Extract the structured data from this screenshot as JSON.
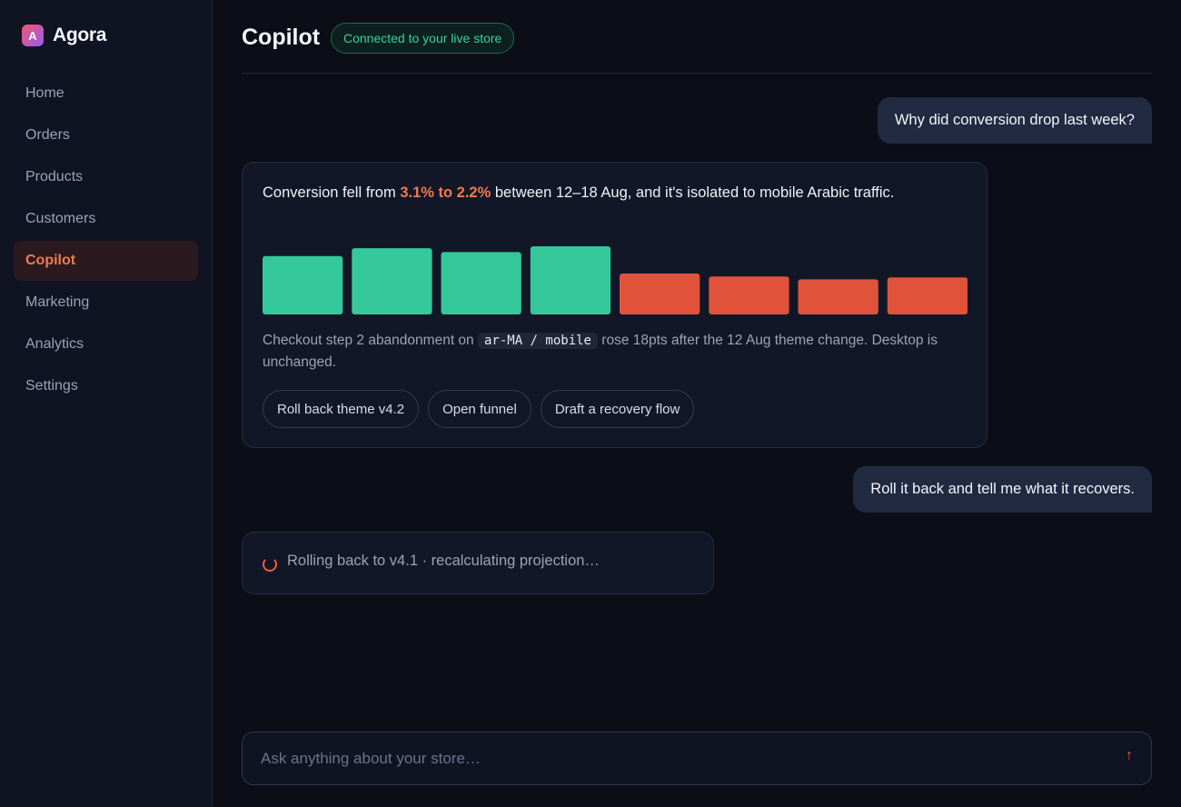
{
  "app": {
    "name": "Agora",
    "logo_letter": "A"
  },
  "sidebar": {
    "items": [
      {
        "label": "Home"
      },
      {
        "label": "Orders"
      },
      {
        "label": "Products"
      },
      {
        "label": "Customers"
      },
      {
        "label": "Copilot",
        "active": true
      },
      {
        "label": "Marketing"
      },
      {
        "label": "Analytics"
      },
      {
        "label": "Settings"
      }
    ]
  },
  "header": {
    "title": "Copilot",
    "status": "Connected to your live store"
  },
  "conversation": {
    "user_message_1": "Why did conversion drop last week?",
    "ai_reply": {
      "text_before": "Conversion fell from ",
      "highlight": "3.1% to 2.2%",
      "text_after": " between 12–18 Aug, and it's isolated to mobile Arabic traffic.",
      "caption_before": "Checkout step 2 abandonment on ",
      "caption_code": "ar-MA / mobile",
      "caption_after": " rose 18pts after the 12 Aug theme change. Desktop is unchanged.",
      "actions": [
        {
          "label": "Roll back theme v4.2"
        },
        {
          "label": "Open funnel"
        },
        {
          "label": "Draft a recovery flow"
        }
      ]
    },
    "user_message_2": "Roll it back and tell me what it recovers.",
    "progress": "Rolling back to v4.1 · recalculating projection…"
  },
  "composer": {
    "placeholder": "Ask anything about your store…",
    "send_icon": "↑"
  },
  "colors": {
    "accent": "#f27a4c",
    "good": "#34c89b",
    "bad": "#e0533a",
    "connected": "#34d399"
  },
  "chart_data": {
    "type": "bar",
    "title": "",
    "xlabel": "",
    "ylabel": "",
    "values": [
      3.0,
      3.4,
      3.2,
      3.5,
      2.1,
      1.95,
      1.8,
      1.9
    ],
    "status": [
      "good",
      "good",
      "good",
      "good",
      "bad",
      "bad",
      "bad",
      "bad"
    ],
    "ylim": [
      0,
      3.5
    ],
    "grid": false,
    "legend": "none"
  }
}
